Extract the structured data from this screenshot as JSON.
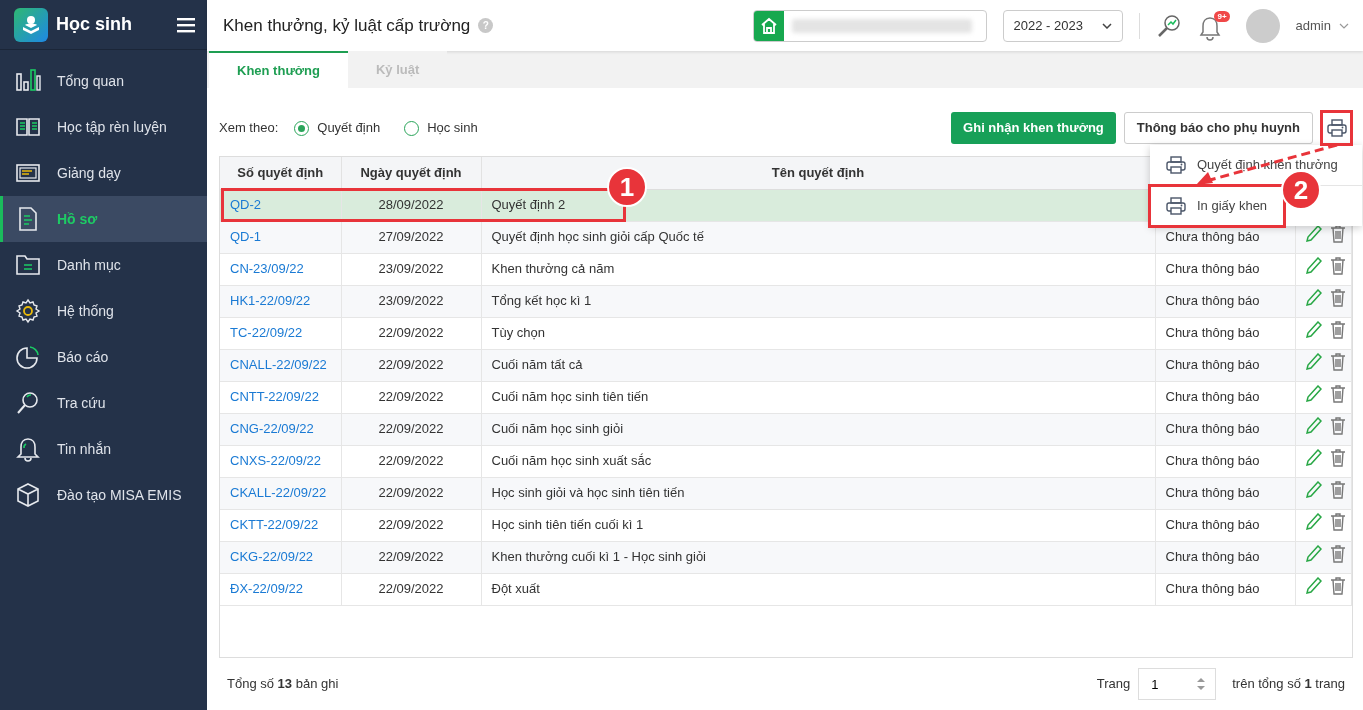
{
  "app": {
    "title": "Học sinh"
  },
  "sidebar": {
    "items": [
      {
        "label": "Tổng quan",
        "selected": false
      },
      {
        "label": "Học tập rèn luyện",
        "selected": false
      },
      {
        "label": "Giảng dạy",
        "selected": false
      },
      {
        "label": "Hồ sơ",
        "selected": true
      },
      {
        "label": "Danh mục",
        "selected": false
      },
      {
        "label": "Hệ thống",
        "selected": false
      },
      {
        "label": "Báo cáo",
        "selected": false
      },
      {
        "label": "Tra cứu",
        "selected": false
      },
      {
        "label": "Tin nhắn",
        "selected": false
      },
      {
        "label": "Đào tạo MISA EMIS",
        "selected": false
      }
    ]
  },
  "header": {
    "title": "Khen thưởng, kỷ luật cấp trường",
    "help": "?",
    "year": "2022 - 2023",
    "notification_badge": "9+",
    "user": "admin"
  },
  "tabs": [
    {
      "label": "Khen thưởng",
      "selected": true
    },
    {
      "label": "Kỷ luật",
      "selected": false
    }
  ],
  "view_by": {
    "label": "Xem theo:",
    "options": [
      {
        "label": "Quyết định",
        "selected": true
      },
      {
        "label": "Học sinh",
        "selected": false
      }
    ]
  },
  "buttons": [
    {
      "label": "Ghi nhận khen thưởng",
      "kind": "primary"
    },
    {
      "label": "Thông báo cho phụ huynh",
      "kind": "outline"
    }
  ],
  "print_menu": {
    "items": [
      {
        "label": "Quyết định khen thưởng"
      },
      {
        "label": "In giấy khen"
      }
    ]
  },
  "table": {
    "columns": [
      "Số quyết định",
      "Ngày quyết định",
      "Tên quyết định"
    ],
    "rows": [
      {
        "code": "QD-2",
        "date": "28/09/2022",
        "name": "Quyết định 2",
        "selected": true
      },
      {
        "code": "QD-1",
        "date": "27/09/2022",
        "name": "Quyết định học sinh giỏi cấp Quốc tế",
        "status": "Chưa thông báo",
        "selected": false
      },
      {
        "code": "CN-23/09/22",
        "date": "23/09/2022",
        "name": "Khen thưởng cả năm",
        "status": "Chưa thông báo",
        "selected": false
      },
      {
        "code": "HK1-22/09/22",
        "date": "23/09/2022",
        "name": "Tổng kết học kì 1",
        "status": "Chưa thông báo",
        "selected": false
      },
      {
        "code": "TC-22/09/22",
        "date": "22/09/2022",
        "name": "Tùy chọn",
        "status": "Chưa thông báo",
        "selected": false
      },
      {
        "code": "CNALL-22/09/22",
        "date": "22/09/2022",
        "name": "Cuối năm tất cả",
        "status": "Chưa thông báo",
        "selected": false
      },
      {
        "code": "CNTT-22/09/22",
        "date": "22/09/2022",
        "name": "Cuối năm học sinh tiên tiến",
        "status": "Chưa thông báo",
        "selected": false
      },
      {
        "code": "CNG-22/09/22",
        "date": "22/09/2022",
        "name": "Cuối năm học sinh giỏi",
        "status": "Chưa thông báo",
        "selected": false
      },
      {
        "code": "CNXS-22/09/22",
        "date": "22/09/2022",
        "name": "Cuối năm học sinh xuất sắc",
        "status": "Chưa thông báo",
        "selected": false
      },
      {
        "code": "CKALL-22/09/22",
        "date": "22/09/2022",
        "name": "Học sinh giỏi và học sinh tiên tiến",
        "status": "Chưa thông báo",
        "selected": false
      },
      {
        "code": "CKTT-22/09/22",
        "date": "22/09/2022",
        "name": "Học sinh tiên tiến cuối kì 1",
        "status": "Chưa thông báo",
        "selected": false
      },
      {
        "code": "CKG-22/09/22",
        "date": "22/09/2022",
        "name": "Khen thưởng cuối kì 1 - Học sinh giỏi",
        "status": "Chưa thông báo",
        "selected": false
      },
      {
        "code": "ĐX-22/09/22",
        "date": "22/09/2022",
        "name": "Đột xuất",
        "status": "Chưa thông báo",
        "selected": false
      }
    ]
  },
  "footer": {
    "total": "Tổng số **13** bản ghi",
    "page_label": "Trang",
    "page": "1",
    "page_total": "trên tổng số **1** trang"
  },
  "annotations": [
    {
      "number": "1"
    },
    {
      "number": "2"
    }
  ]
}
